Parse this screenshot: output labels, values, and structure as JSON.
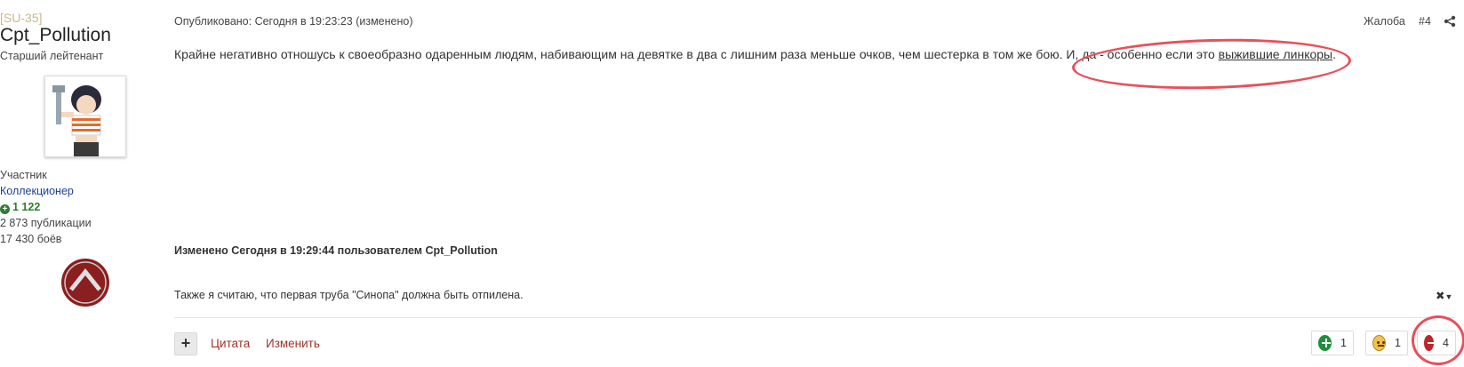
{
  "author": {
    "clan": "[SU-35]",
    "username": "Cpt_Pollution",
    "rank": "Старший лейтенант",
    "group": "Участник",
    "title": "Коллекционер",
    "reputation": "1 122",
    "posts": "2 873 публикации",
    "battles": "17 430 боёв"
  },
  "post": {
    "meta": "Опубликовано: Сегодня в 19:23:23 (изменено)",
    "report": "Жалоба",
    "number": "#4",
    "text_before": "Крайне негативно отношусь к своеобразно одаренным людям, набивающим на девятке в два с лишним раза меньше очков, чем шестерка в том же бою. И, да - особенно если это ",
    "link_text": "выжившие линкоры",
    "text_after": ".",
    "edited": "Изменено Сегодня в 19:29:44 пользователем Cpt_Pollution",
    "signature": "Также я считаю, что первая труба \"Синопа\" должна быть отпилена."
  },
  "actions": {
    "multiquote": "+",
    "quote": "Цитата",
    "edit": "Изменить"
  },
  "reactions": {
    "plus_count": "1",
    "smile_count": "1",
    "minus_count": "4"
  },
  "colors": {
    "link_red": "#a0332a",
    "annotation_red": "#e8505b",
    "plus_green": "#1e8f3c",
    "minus_red": "#c0232b",
    "title_blue": "#1a3e9e"
  }
}
